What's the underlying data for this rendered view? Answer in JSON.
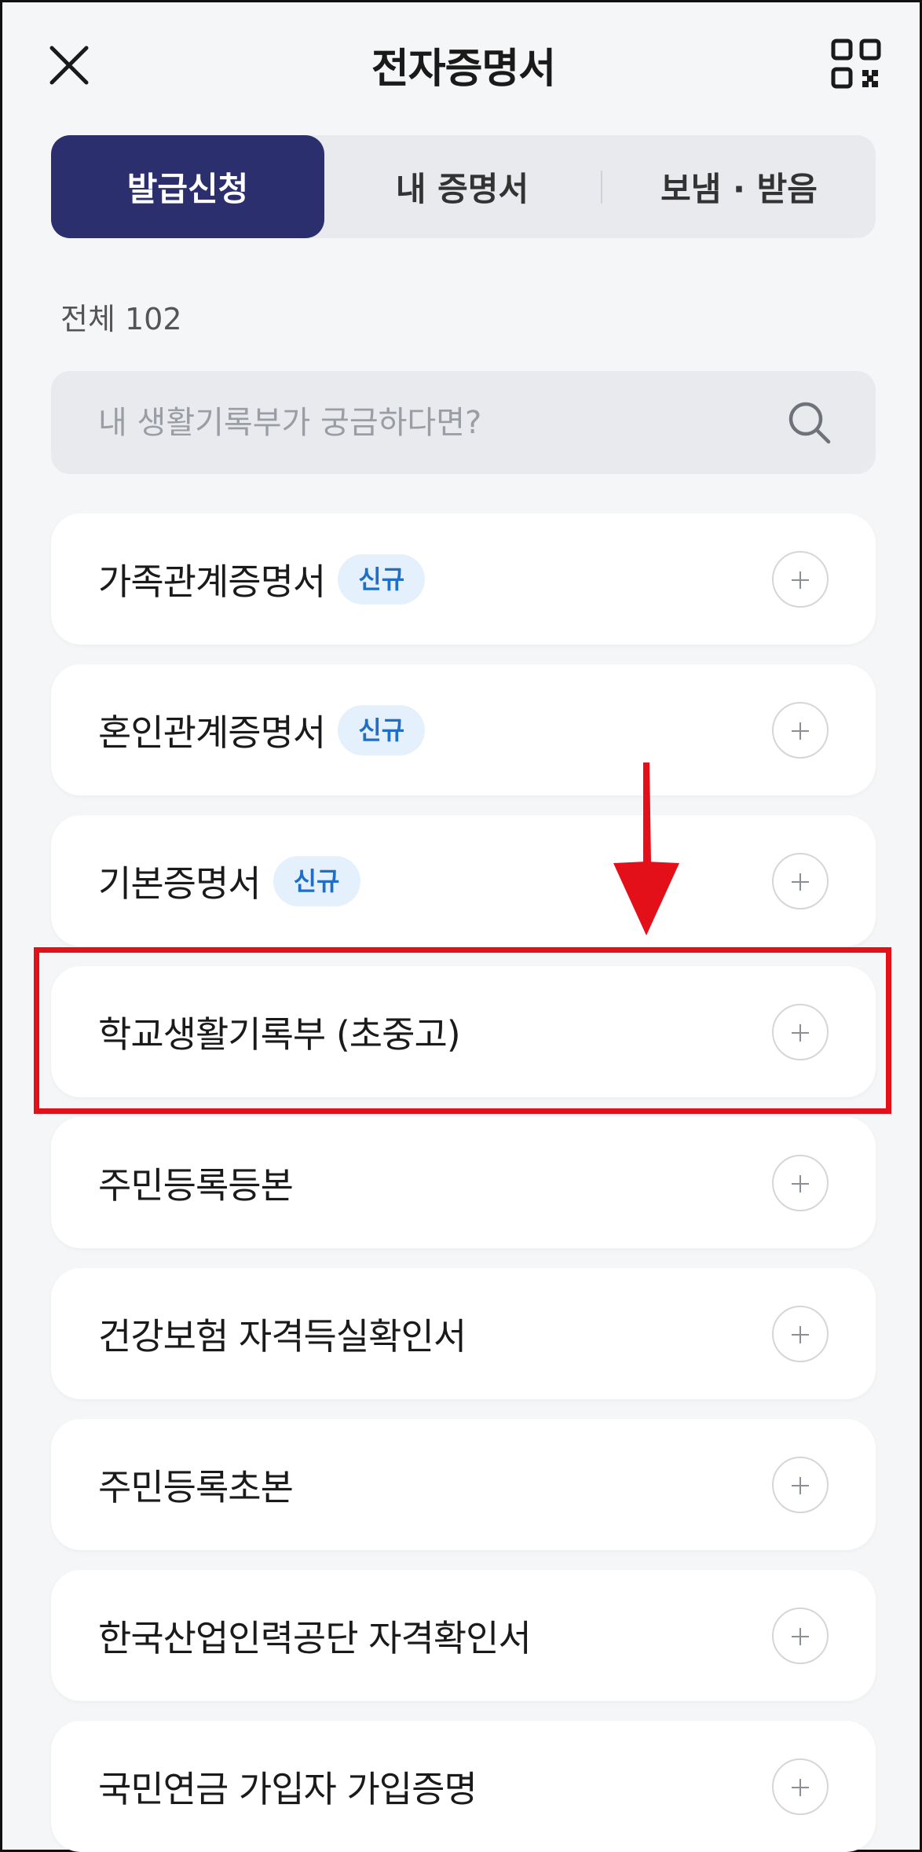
{
  "header": {
    "title": "전자증명서",
    "close_icon": "close-icon",
    "qr_icon": "qr-code-icon"
  },
  "tabs": [
    {
      "label": "발급신청",
      "active": true
    },
    {
      "label": "내 증명서",
      "active": false
    },
    {
      "label": "보냄 · 받음",
      "active": false
    }
  ],
  "total_count": "전체 102",
  "search": {
    "placeholder": "내 생활기록부가 궁금하다면?",
    "value": "",
    "icon": "search-icon"
  },
  "certificates": [
    {
      "label": "가족관계증명서",
      "badge": "신규"
    },
    {
      "label": "혼인관계증명서",
      "badge": "신규"
    },
    {
      "label": "기본증명서",
      "badge": "신규"
    },
    {
      "label": "학교생활기록부 (초중고)"
    },
    {
      "label": "주민등록등본"
    },
    {
      "label": "건강보험 자격득실확인서"
    },
    {
      "label": "주민등록초본"
    },
    {
      "label": "한국산업인력공단 자격확인서"
    },
    {
      "label": "국민연금 가입자 가입증명"
    }
  ],
  "colors": {
    "active_tab": "#2c2f6e",
    "badge_bg": "#e4f0fc",
    "badge_text": "#1f6ec8",
    "annotation": "#e3101a",
    "background": "#f5f6f8"
  }
}
